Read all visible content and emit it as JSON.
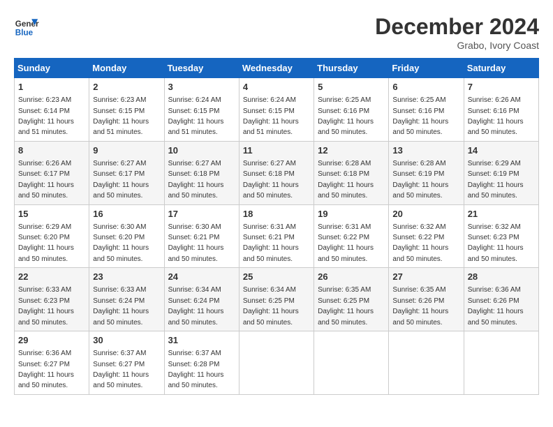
{
  "logo": {
    "line1": "General",
    "line2": "Blue"
  },
  "title": "December 2024",
  "location": "Grabo, Ivory Coast",
  "days_header": [
    "Sunday",
    "Monday",
    "Tuesday",
    "Wednesday",
    "Thursday",
    "Friday",
    "Saturday"
  ],
  "weeks": [
    [
      {
        "day": "1",
        "sunrise": "6:23 AM",
        "sunset": "6:14 PM",
        "daylight": "11 hours and 51 minutes."
      },
      {
        "day": "2",
        "sunrise": "6:23 AM",
        "sunset": "6:15 PM",
        "daylight": "11 hours and 51 minutes."
      },
      {
        "day": "3",
        "sunrise": "6:24 AM",
        "sunset": "6:15 PM",
        "daylight": "11 hours and 51 minutes."
      },
      {
        "day": "4",
        "sunrise": "6:24 AM",
        "sunset": "6:15 PM",
        "daylight": "11 hours and 51 minutes."
      },
      {
        "day": "5",
        "sunrise": "6:25 AM",
        "sunset": "6:16 PM",
        "daylight": "11 hours and 50 minutes."
      },
      {
        "day": "6",
        "sunrise": "6:25 AM",
        "sunset": "6:16 PM",
        "daylight": "11 hours and 50 minutes."
      },
      {
        "day": "7",
        "sunrise": "6:26 AM",
        "sunset": "6:16 PM",
        "daylight": "11 hours and 50 minutes."
      }
    ],
    [
      {
        "day": "8",
        "sunrise": "6:26 AM",
        "sunset": "6:17 PM",
        "daylight": "11 hours and 50 minutes."
      },
      {
        "day": "9",
        "sunrise": "6:27 AM",
        "sunset": "6:17 PM",
        "daylight": "11 hours and 50 minutes."
      },
      {
        "day": "10",
        "sunrise": "6:27 AM",
        "sunset": "6:18 PM",
        "daylight": "11 hours and 50 minutes."
      },
      {
        "day": "11",
        "sunrise": "6:27 AM",
        "sunset": "6:18 PM",
        "daylight": "11 hours and 50 minutes."
      },
      {
        "day": "12",
        "sunrise": "6:28 AM",
        "sunset": "6:18 PM",
        "daylight": "11 hours and 50 minutes."
      },
      {
        "day": "13",
        "sunrise": "6:28 AM",
        "sunset": "6:19 PM",
        "daylight": "11 hours and 50 minutes."
      },
      {
        "day": "14",
        "sunrise": "6:29 AM",
        "sunset": "6:19 PM",
        "daylight": "11 hours and 50 minutes."
      }
    ],
    [
      {
        "day": "15",
        "sunrise": "6:29 AM",
        "sunset": "6:20 PM",
        "daylight": "11 hours and 50 minutes."
      },
      {
        "day": "16",
        "sunrise": "6:30 AM",
        "sunset": "6:20 PM",
        "daylight": "11 hours and 50 minutes."
      },
      {
        "day": "17",
        "sunrise": "6:30 AM",
        "sunset": "6:21 PM",
        "daylight": "11 hours and 50 minutes."
      },
      {
        "day": "18",
        "sunrise": "6:31 AM",
        "sunset": "6:21 PM",
        "daylight": "11 hours and 50 minutes."
      },
      {
        "day": "19",
        "sunrise": "6:31 AM",
        "sunset": "6:22 PM",
        "daylight": "11 hours and 50 minutes."
      },
      {
        "day": "20",
        "sunrise": "6:32 AM",
        "sunset": "6:22 PM",
        "daylight": "11 hours and 50 minutes."
      },
      {
        "day": "21",
        "sunrise": "6:32 AM",
        "sunset": "6:23 PM",
        "daylight": "11 hours and 50 minutes."
      }
    ],
    [
      {
        "day": "22",
        "sunrise": "6:33 AM",
        "sunset": "6:23 PM",
        "daylight": "11 hours and 50 minutes."
      },
      {
        "day": "23",
        "sunrise": "6:33 AM",
        "sunset": "6:24 PM",
        "daylight": "11 hours and 50 minutes."
      },
      {
        "day": "24",
        "sunrise": "6:34 AM",
        "sunset": "6:24 PM",
        "daylight": "11 hours and 50 minutes."
      },
      {
        "day": "25",
        "sunrise": "6:34 AM",
        "sunset": "6:25 PM",
        "daylight": "11 hours and 50 minutes."
      },
      {
        "day": "26",
        "sunrise": "6:35 AM",
        "sunset": "6:25 PM",
        "daylight": "11 hours and 50 minutes."
      },
      {
        "day": "27",
        "sunrise": "6:35 AM",
        "sunset": "6:26 PM",
        "daylight": "11 hours and 50 minutes."
      },
      {
        "day": "28",
        "sunrise": "6:36 AM",
        "sunset": "6:26 PM",
        "daylight": "11 hours and 50 minutes."
      }
    ],
    [
      {
        "day": "29",
        "sunrise": "6:36 AM",
        "sunset": "6:27 PM",
        "daylight": "11 hours and 50 minutes."
      },
      {
        "day": "30",
        "sunrise": "6:37 AM",
        "sunset": "6:27 PM",
        "daylight": "11 hours and 50 minutes."
      },
      {
        "day": "31",
        "sunrise": "6:37 AM",
        "sunset": "6:28 PM",
        "daylight": "11 hours and 50 minutes."
      },
      null,
      null,
      null,
      null
    ]
  ]
}
